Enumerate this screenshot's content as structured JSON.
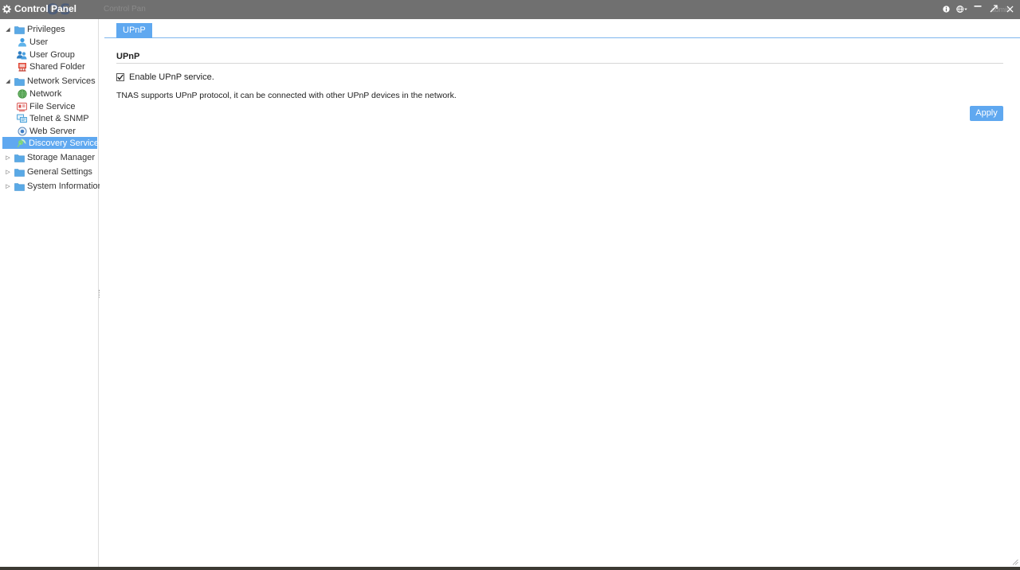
{
  "window": {
    "title": "Control Panel",
    "ghost_logo": "OS",
    "ghost_title": "Control Pan",
    "ghost_user": "admin"
  },
  "sidebar": {
    "groups": [
      {
        "label": "Privileges",
        "expanded": true,
        "items": [
          {
            "label": "User",
            "icon": "user-icon"
          },
          {
            "label": "User Group",
            "icon": "user-group-icon"
          },
          {
            "label": "Shared Folder",
            "icon": "shared-folder-icon"
          }
        ]
      },
      {
        "label": "Network Services",
        "expanded": true,
        "items": [
          {
            "label": "Network",
            "icon": "globe-icon"
          },
          {
            "label": "File Service",
            "icon": "file-service-icon"
          },
          {
            "label": "Telnet & SNMP",
            "icon": "telnet-icon"
          },
          {
            "label": "Web Server",
            "icon": "web-server-icon"
          },
          {
            "label": "Discovery Service",
            "icon": "discovery-icon",
            "selected": true
          }
        ]
      },
      {
        "label": "Storage Manager",
        "expanded": false,
        "items": []
      },
      {
        "label": "General Settings",
        "expanded": false,
        "items": []
      },
      {
        "label": "System Information",
        "expanded": false,
        "items": []
      }
    ]
  },
  "main": {
    "tabs": [
      {
        "label": "UPnP",
        "active": true
      }
    ],
    "section_title": "UPnP",
    "enable_checkbox": {
      "label": "Enable UPnP service.",
      "checked": true
    },
    "description": "TNAS supports UPnP protocol, it can be connected with other UPnP devices in the network.",
    "apply_label": "Apply"
  },
  "colors": {
    "accent": "#5fa8f0",
    "titlebar": "#707070",
    "folder": "#5aa9e6"
  }
}
